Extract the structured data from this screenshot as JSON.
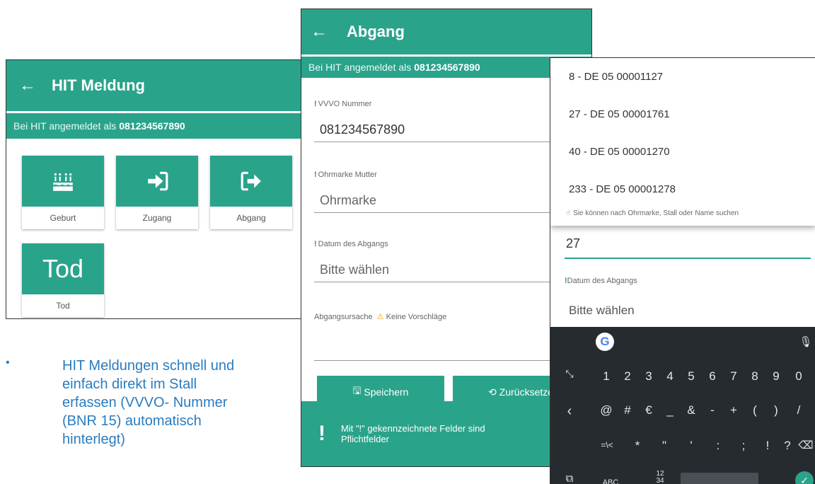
{
  "screen1": {
    "title": "HIT Meldung",
    "status_prefix": "Bei HIT angemeldet als",
    "status_number": "081234567890",
    "tiles": [
      {
        "label": "Geburt",
        "icon": "birthday-cake-icon"
      },
      {
        "label": "Zugang",
        "icon": "sign-in-icon"
      },
      {
        "label": "Abgang",
        "icon": "sign-out-icon"
      },
      {
        "label": "Tod",
        "big_text": "Tod"
      }
    ]
  },
  "screen2": {
    "title": "Abgang",
    "status_prefix": "Bei HIT angemeldet als",
    "status_number": "081234567890",
    "fields": {
      "vvvo_label": "VVVO Nummer",
      "vvvo_value": "081234567890",
      "mutter_label": "Ohrmarke Mutter",
      "mutter_placeholder": "Ohrmarke",
      "datum_label": "Datum des Abgangs",
      "datum_placeholder": "Bitte wählen",
      "ursache_label": "Abgangsursache",
      "ursache_warning": "Keine Vorschläge"
    },
    "buttons": {
      "save": "Speichern",
      "reset": "Zurücksetzen"
    },
    "footer": {
      "mark": "!",
      "text_line1": "Mit \"!\" gekennzeichnete Felder sind",
      "text_line2": "Pflichtfelder"
    }
  },
  "screen3": {
    "options": [
      "8 - DE 05 00001127",
      "27 - DE 05 00001761",
      "40 - DE 05 00001270",
      "233 - DE 05 00001278"
    ],
    "hint": "Sie können nach Ohrmarke, Stall oder Name suchen",
    "input_value": "27",
    "datum_label": "Datum des Abgangs",
    "datum_placeholder": "Bitte wählen",
    "keyboard": {
      "row1": [
        "1",
        "2",
        "3",
        "4",
        "5",
        "6",
        "7",
        "8",
        "9",
        "0"
      ],
      "row2": [
        "@",
        "#",
        "€",
        "_",
        "&",
        "-",
        "+",
        "(",
        ")",
        "/"
      ],
      "row3": [
        "=\\<",
        "*",
        "\"",
        "'",
        ":",
        ";",
        "!",
        "?"
      ],
      "abc": "ABC",
      "comma": ",",
      "frac_top": "12",
      "frac_bottom": "34",
      "period": "."
    }
  },
  "bullet": {
    "marker": "•",
    "text": "HIT Meldungen schnell und einfach direkt im Stall erfassen (VVVO- Nummer (BNR 15) automatisch hinterlegt)"
  },
  "colors": {
    "teal": "#2aa38b",
    "bullet_blue": "#2a7cbf",
    "keyboard_bg": "#262b30",
    "warning": "#e8a300"
  }
}
